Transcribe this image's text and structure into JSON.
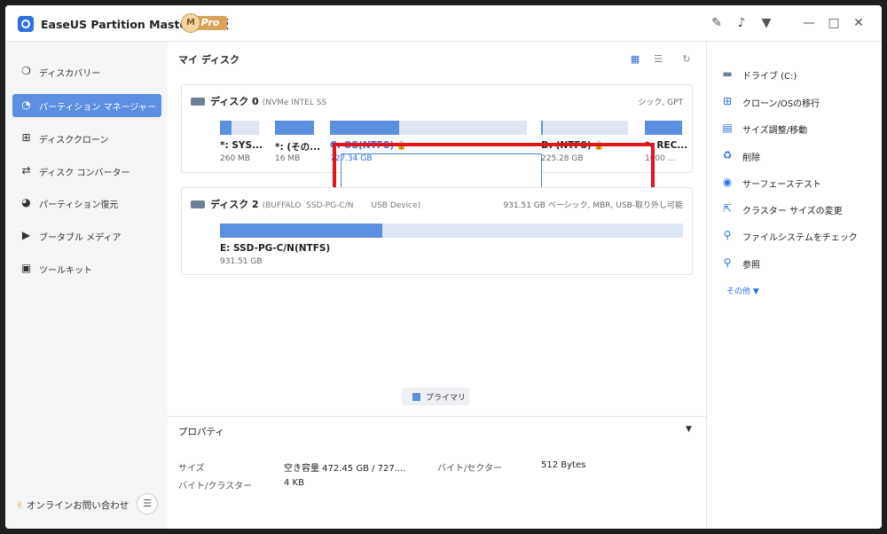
{
  "app": {
    "title": "EaseUS Partition Master Pro版",
    "badge_m": "M",
    "badge_pro": "Pro"
  },
  "titlebar_icons": [
    "feedback-icon",
    "bell-icon",
    "download-icon",
    "minimize-icon",
    "maximize-icon",
    "close-icon"
  ],
  "sidebar": {
    "items": [
      {
        "label": "ディスカバリー",
        "icon": "compass-icon",
        "active": false
      },
      {
        "label": "パーティション マネージャー",
        "icon": "pie-chart-icon",
        "active": true
      },
      {
        "label": "ディスククローン",
        "icon": "plus-square-icon",
        "active": false
      },
      {
        "label": "ディスク コンバーター",
        "icon": "convert-icon",
        "active": false
      },
      {
        "label": "パーティション復元",
        "icon": "restore-icon",
        "active": false
      },
      {
        "label": "ブータブル メディア",
        "icon": "bootable-media-icon",
        "active": false
      },
      {
        "label": "ツールキット",
        "icon": "toolbox-icon",
        "active": false
      }
    ],
    "contact": "オンラインお問い合わせ"
  },
  "main": {
    "title": "マイ ディスク",
    "disks": [
      {
        "label": "ディスク 0",
        "sub": "(NVMe INTEL SS",
        "info": "シック, GPT",
        "partitions": [
          {
            "name": "*: SYS...",
            "size": "260 MB",
            "fill": 0.3
          },
          {
            "name": "*: (その...",
            "size": "16 MB",
            "fill": 1.0
          },
          {
            "name": "C: OS(NTFS)",
            "size": "727.34 GB",
            "fill": 0.35,
            "locked": true,
            "selected": true
          },
          {
            "name": "D: (NTFS)",
            "size": "225.28 GB",
            "fill": 0.02,
            "locked": true
          },
          {
            "name": "*: REC...",
            "size": "1000 ...",
            "fill": 1.0
          }
        ]
      },
      {
        "label": "ディスク 2",
        "sub": "(BUFFALO  SSD-PG-C/N       USB Device)",
        "info": "931.51 GB ベーシック, MBR, USB-取り外し可能",
        "partitions": [
          {
            "name": "E: SSD-PG-C/N(NTFS)",
            "size": "931.51 GB",
            "fill": 0.35
          }
        ]
      }
    ],
    "legend": "プライマリ",
    "properties": {
      "title": "プロパティ",
      "rows": [
        {
          "k1": "サイズ",
          "v1": "空き容量 472.45 GB / 727....",
          "k2": "バイト/セクター",
          "v2": "512 Bytes"
        },
        {
          "k1": "バイト/クラスター",
          "v1": "4 KB"
        }
      ]
    }
  },
  "right_panel": {
    "drive": "ドライブ (C:)",
    "actions": [
      {
        "label": "クローン/OSの移行",
        "icon": "windows-icon"
      },
      {
        "label": "サイズ調整/移動",
        "icon": "resize-icon"
      },
      {
        "label": "削除",
        "icon": "trash-icon"
      },
      {
        "label": "サーフェーステスト",
        "icon": "surface-test-icon"
      },
      {
        "label": "クラスター サイズの変更",
        "icon": "cluster-icon"
      },
      {
        "label": "ファイルシステムをチェック",
        "icon": "check-fs-icon"
      },
      {
        "label": "参照",
        "icon": "browse-icon"
      }
    ],
    "more": "その他 ▼"
  },
  "colors": {
    "accent": "#5b8fe0",
    "highlight": "#e4141c",
    "bar_bg": "#dfe6f3"
  }
}
